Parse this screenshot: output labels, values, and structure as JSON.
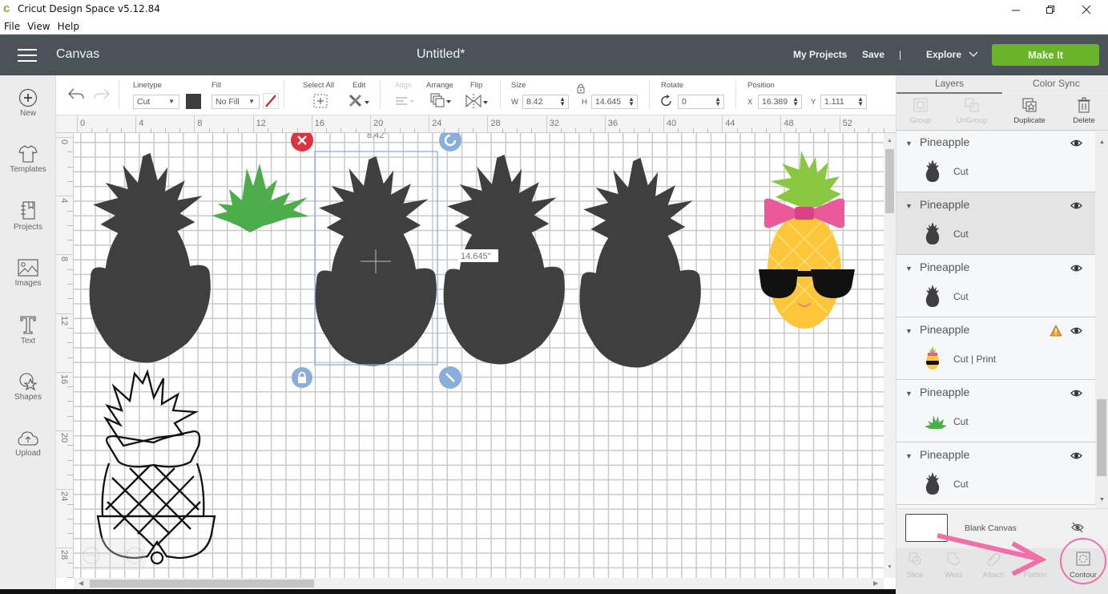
{
  "window": {
    "title": "Cricut Design Space  v5.12.84",
    "controls": [
      "minimize",
      "restore",
      "close"
    ]
  },
  "menubar": [
    "File",
    "View",
    "Help"
  ],
  "appbar": {
    "section": "Canvas",
    "document_title": "Untitled*",
    "my_projects": "My Projects",
    "save": "Save",
    "divider": "|",
    "explore": "Explore",
    "make_it": "Make It",
    "make_it_color": "#6ab42a"
  },
  "leftbar": [
    {
      "label": "New",
      "icon": "plus-circle-icon"
    },
    {
      "label": "Templates",
      "icon": "tshirt-icon"
    },
    {
      "label": "Projects",
      "icon": "notebook-icon"
    },
    {
      "label": "Images",
      "icon": "image-icon"
    },
    {
      "label": "Text",
      "icon": "text-t-icon"
    },
    {
      "label": "Shapes",
      "icon": "shapes-icon"
    },
    {
      "label": "Upload",
      "icon": "cloud-upload-icon"
    }
  ],
  "toolbar": {
    "linetype_label": "Linetype",
    "linetype_value": "Cut",
    "linetype_color": "#3d3d3d",
    "fill_label": "Fill",
    "fill_value": "No Fill",
    "select_all_label": "Select All",
    "edit_label": "Edit",
    "align_label": "Align",
    "arrange_label": "Arrange",
    "flip_label": "Flip",
    "size_label": "Size",
    "w_label": "W",
    "w_value": "8.42",
    "h_label": "H",
    "h_value": "14.645",
    "rotate_label": "Rotate",
    "rotate_value": "0",
    "position_label": "Position",
    "x_label": "X",
    "x_value": "16.389",
    "y_label": "Y",
    "y_value": "1.111"
  },
  "ruler": {
    "top": [
      "0",
      "4",
      "8",
      "12",
      "16",
      "20",
      "24",
      "28",
      "32",
      "36",
      "40",
      "44",
      "48",
      "52"
    ],
    "left": [
      "0",
      "4",
      "8",
      "12",
      "16",
      "20",
      "24",
      "28"
    ]
  },
  "canvas": {
    "selection_width_label": "8.42\"",
    "selection_height_label": "14.645\"",
    "objects": [
      {
        "name": "pineapple-silhouette",
        "color": "#3f3f3f"
      },
      {
        "name": "pineapple-leaves",
        "color": "#4cad4a"
      },
      {
        "name": "pineapple-silhouette-selected",
        "color": "#3f3f3f"
      },
      {
        "name": "pineapple-silhouette",
        "color": "#3f3f3f"
      },
      {
        "name": "pineapple-silhouette",
        "color": "#3f3f3f"
      },
      {
        "name": "pineapple-print-then-cut",
        "color": "#fcc53a"
      },
      {
        "name": "pineapple-outline",
        "color": "#111111"
      }
    ]
  },
  "panel": {
    "tabs": [
      "Layers",
      "Color Sync"
    ],
    "active_tab": "Layers",
    "tools": [
      {
        "label": "Group",
        "enabled": false
      },
      {
        "label": "UnGroup",
        "enabled": false
      },
      {
        "label": "Duplicate",
        "enabled": true
      },
      {
        "label": "Delete",
        "enabled": true
      }
    ],
    "layers": [
      {
        "name": "Pineapple",
        "operation": "Cut",
        "thumb": "dark",
        "selected": false,
        "warning": false
      },
      {
        "name": "Pineapple",
        "operation": "Cut",
        "thumb": "dark",
        "selected": true,
        "warning": false
      },
      {
        "name": "Pineapple",
        "operation": "Cut",
        "thumb": "dark",
        "selected": false,
        "warning": false
      },
      {
        "name": "Pineapple",
        "operation": "Cut  |  Print",
        "thumb": "color",
        "selected": false,
        "warning": true
      },
      {
        "name": "Pineapple",
        "operation": "Cut",
        "thumb": "leaves",
        "selected": false,
        "warning": false
      },
      {
        "name": "Pineapple",
        "operation": "Cut",
        "thumb": "dark",
        "selected": false,
        "warning": false
      }
    ],
    "blank_canvas": "Blank Canvas",
    "bottom_tools": [
      {
        "label": "Slice",
        "enabled": false
      },
      {
        "label": "Weld",
        "enabled": false
      },
      {
        "label": "Attach",
        "enabled": false
      },
      {
        "label": "Flatten",
        "enabled": false
      },
      {
        "label": "Contour",
        "enabled": true
      }
    ],
    "annotation_color": "#f06fa8"
  }
}
